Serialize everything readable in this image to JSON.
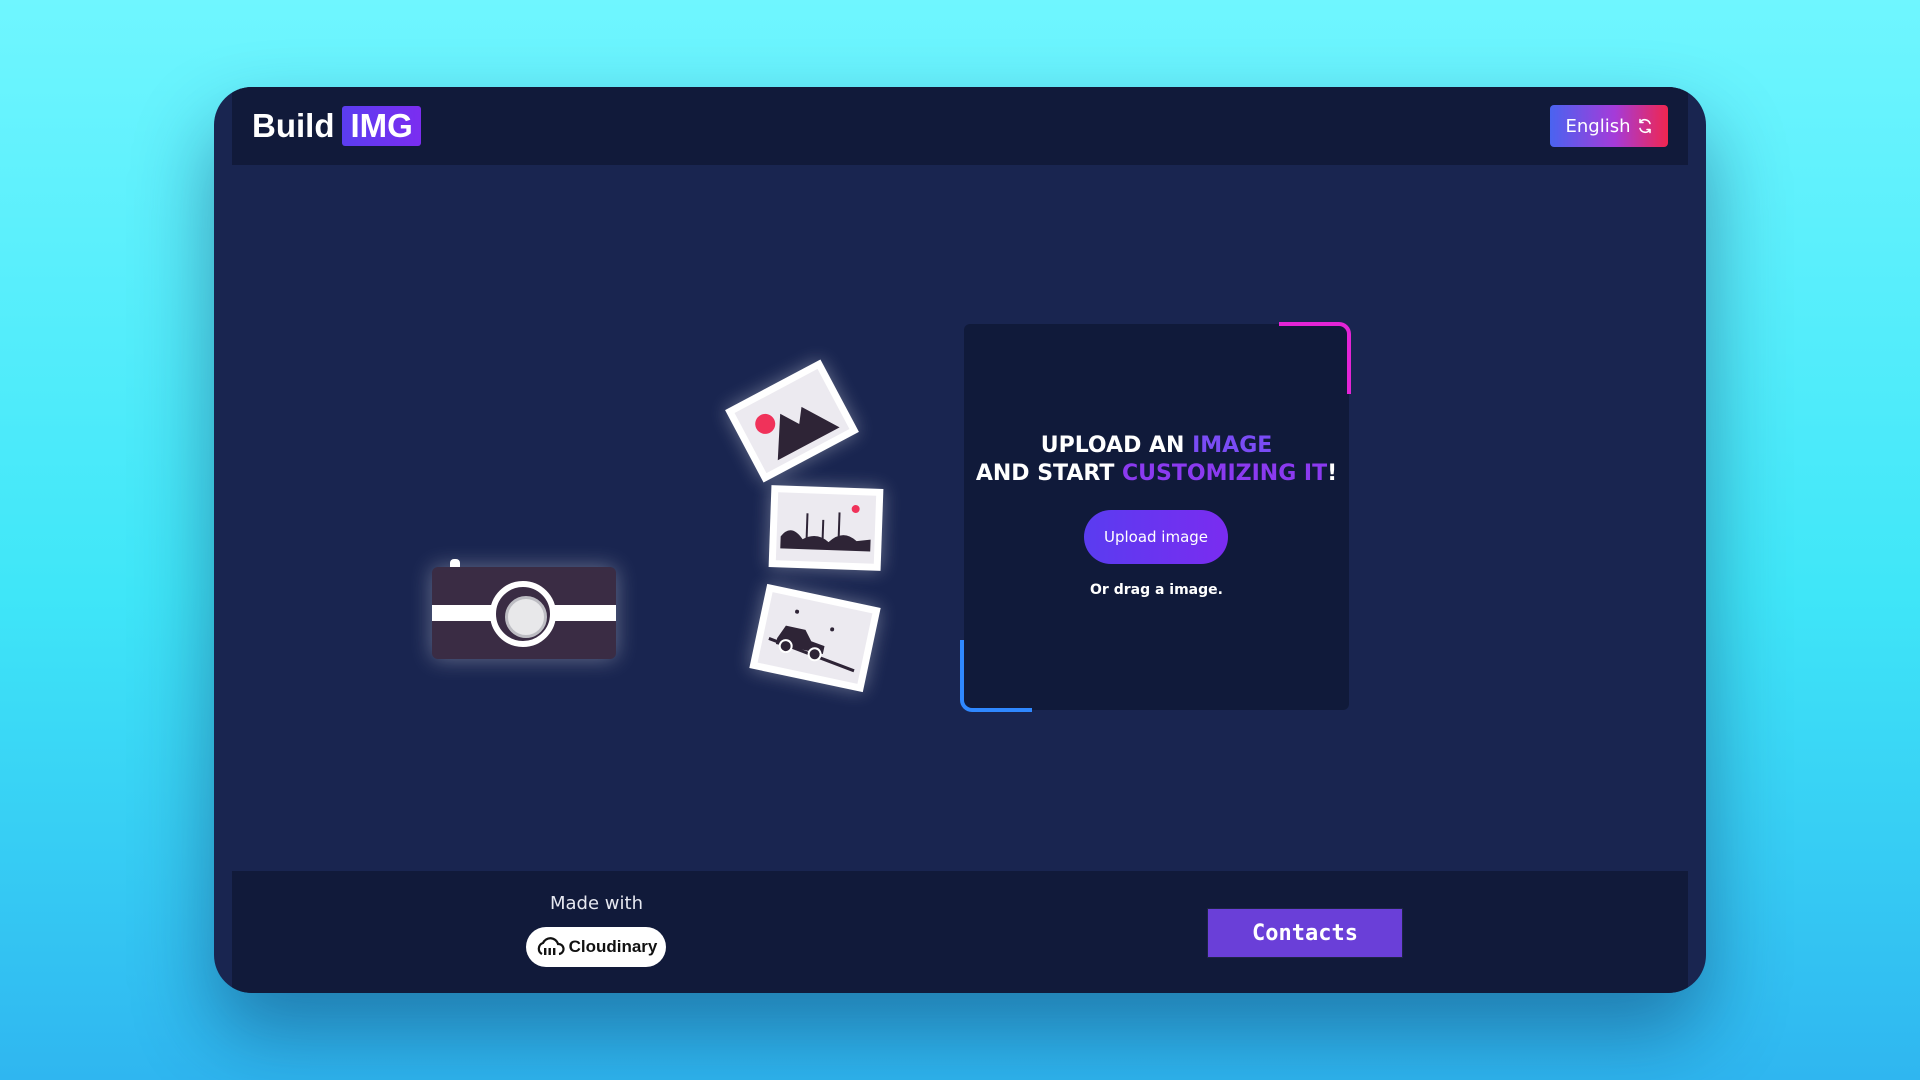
{
  "header": {
    "logo_build": "Build",
    "logo_img": "IMG",
    "language_label": "English"
  },
  "upload_card": {
    "title_line1_prefix": "UPLOAD AN ",
    "title_line1_highlight": "IMAGE",
    "title_line2_prefix": "AND START ",
    "title_line2_highlight": "CUSTOMIZING IT",
    "title_line2_suffix": "!",
    "upload_button_label": "Upload image",
    "drag_text": "Or drag a image."
  },
  "footer": {
    "made_with_label": "Made with",
    "cloudinary_label": "Cloudinary",
    "contacts_label": "Contacts"
  },
  "colors": {
    "accent_purple": "#6a3fd8",
    "accent_magenta": "#e324d6",
    "accent_blue": "#2f88ff",
    "background_cyan": "#3fe6f8"
  }
}
